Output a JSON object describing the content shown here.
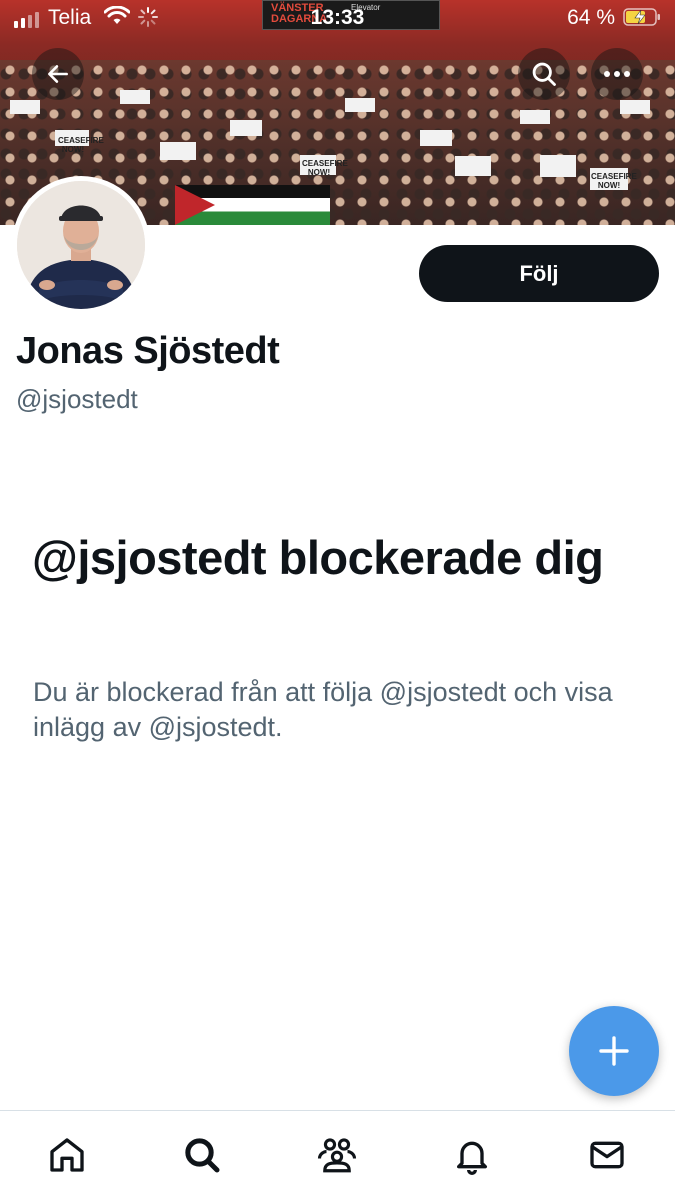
{
  "status_bar": {
    "carrier": "Telia",
    "time": "13:33",
    "battery_percent": "64 %",
    "icons": [
      "signal-icon",
      "wifi-icon",
      "loading-spinner-icon",
      "battery-charging-icon"
    ]
  },
  "banner": {
    "stage_sign_lines": [
      "VÄNSTER",
      "DAGARNA"
    ],
    "elevator_label": "Elevator",
    "sign_text": "CEASEFIRE NOW!"
  },
  "header_buttons": {
    "back_icon": "arrow-left-icon",
    "search_icon": "search-icon",
    "more_icon": "more-horizontal-icon"
  },
  "profile": {
    "display_name": "Jonas Sjöstedt",
    "handle": "@jsjostedt",
    "follow_label": "Följ"
  },
  "blocked": {
    "title": "@jsjostedt blockerade dig",
    "description": "Du är blockerad från att följa @jsjostedt och visa inlägg av @jsjostedt."
  },
  "fab": {
    "icon": "plus-icon"
  },
  "tabbar": {
    "items": [
      {
        "icon": "home-icon"
      },
      {
        "icon": "search-icon"
      },
      {
        "icon": "communities-icon"
      },
      {
        "icon": "bell-icon"
      },
      {
        "icon": "mail-icon"
      }
    ]
  },
  "colors": {
    "text_primary": "#0f1419",
    "text_secondary": "#536471",
    "follow_bg": "#0f1419",
    "fab_bg": "#4b99e9",
    "divider": "#d8e0e6"
  }
}
